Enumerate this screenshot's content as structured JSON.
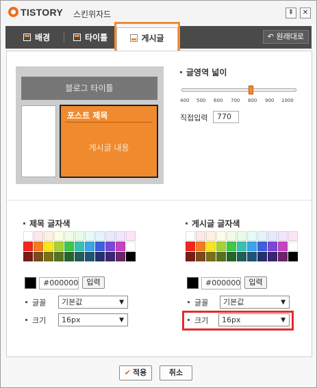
{
  "titlebar": {
    "logo": "TISTORY",
    "title": "스킨위자드",
    "pin_icon": "pin-icon",
    "close_icon": "close-icon"
  },
  "tabs": [
    {
      "label": "배경",
      "icon": "layout-icon",
      "active": false
    },
    {
      "label": "타이틀",
      "icon": "layout-icon",
      "active": false
    },
    {
      "label": "게시글",
      "icon": "layout-icon",
      "active": true
    }
  ],
  "revert_label": "원래대로",
  "preview": {
    "blog_title": "블로그 타이틀",
    "post_title": "포스트 제목",
    "post_body": "게시글 내용"
  },
  "width": {
    "title": "글영역 넓이",
    "ticks": [
      "400",
      "500",
      "600",
      "700",
      "800",
      "900",
      "1000"
    ],
    "direct_label": "직접입력",
    "value": "770"
  },
  "title_color": {
    "title": "제목 글자색",
    "hex": "#000000",
    "apply_label": "입력",
    "font_label": "글꼴",
    "font_value": "기본값",
    "size_label": "크기",
    "size_value": "16px"
  },
  "body_color": {
    "title": "게시글 글자색",
    "hex": "#000000",
    "apply_label": "입력",
    "font_label": "글꼴",
    "font_value": "기본값",
    "size_label": "크기",
    "size_value": "16px"
  },
  "palette": [
    [
      "#ffffff",
      "#fde9e9",
      "#fdf1e4",
      "#fdfce4",
      "#f1fce4",
      "#e8fbe9",
      "#e4fbf7",
      "#e6f3fc",
      "#e8eafc",
      "#f1e6fc",
      "#fce6f6"
    ],
    [
      "#f2261d",
      "#f47b20",
      "#f7e51f",
      "#a6d234",
      "#3ec849",
      "#35c3b1",
      "#38a6e8",
      "#3d5fe0",
      "#7b47d8",
      "#c742c1",
      "#ffffff"
    ],
    [
      "#7b1b17",
      "#7b4a1a",
      "#7a7018",
      "#55731e",
      "#23652a",
      "#215e58",
      "#215379",
      "#24306e",
      "#3a2570",
      "#6b2467",
      "#000000"
    ]
  ],
  "footer": {
    "apply_label": "적용",
    "cancel_label": "취소"
  },
  "colors": {
    "accent": "#f58a2e",
    "highlight": "#e32b2b"
  }
}
